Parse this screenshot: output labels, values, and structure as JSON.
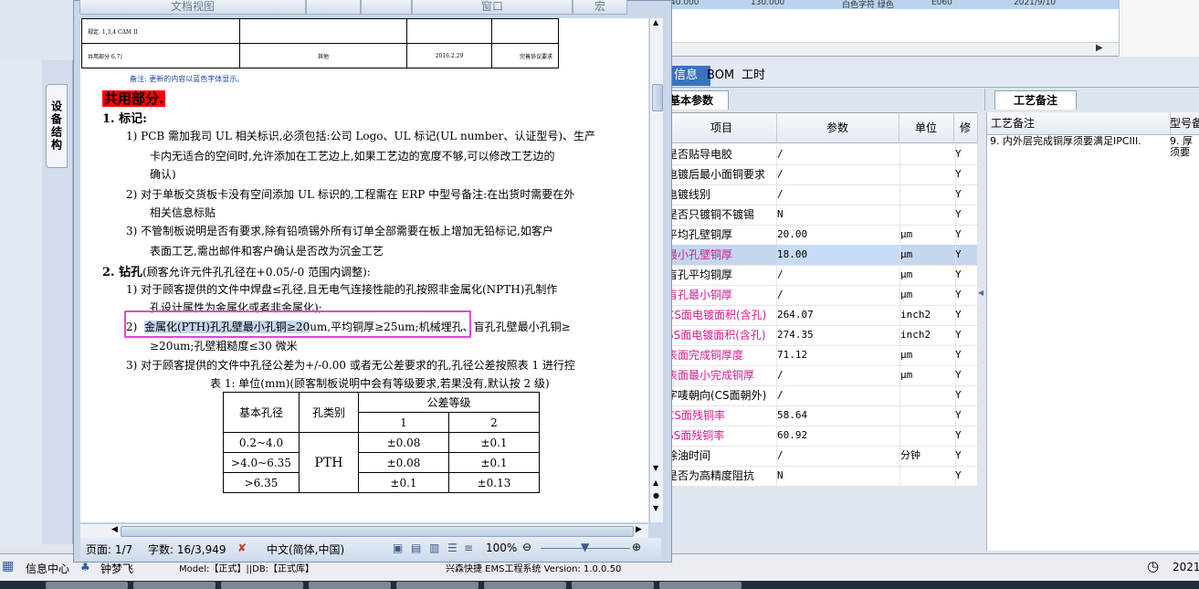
{
  "erp": {
    "top_row": [
      "40.000",
      "130.000",
      "白色字符  绿色",
      "E060",
      "2021/9/10"
    ],
    "tabs": [
      "信息",
      "BOM",
      "工时"
    ],
    "left_tab": "设备结构",
    "basic_params": {
      "section_title": "基本参数",
      "columns": [
        "项目",
        "参数",
        "单位",
        "修"
      ],
      "rows": [
        {
          "item": "是否贴导电胶",
          "value": "/",
          "unit": "",
          "flag": "Y"
        },
        {
          "item": "电镀后最小面铜要求",
          "value": "/",
          "unit": "",
          "flag": "Y"
        },
        {
          "item": "电镀线别",
          "value": "/",
          "unit": "",
          "flag": "Y"
        },
        {
          "item": "是否只镀铜不镀锡",
          "value": "N",
          "unit": "",
          "flag": "Y"
        },
        {
          "item": "平均孔壁铜厚",
          "value": "20.00",
          "unit": "μm",
          "flag": "Y"
        },
        {
          "item": "最小孔壁铜厚",
          "value": "18.00",
          "unit": "μm",
          "flag": "Y"
        },
        {
          "item": "盲孔平均铜厚",
          "value": "/",
          "unit": "μm",
          "flag": "Y"
        },
        {
          "item": "盲孔最小铜厚",
          "value": "/",
          "unit": "μm",
          "flag": "Y"
        },
        {
          "item": "CS面电镀面积(含孔)",
          "value": "264.07",
          "unit": "inch2",
          "flag": "Y"
        },
        {
          "item": "SS面电镀面积(含孔)",
          "value": "274.35",
          "unit": "inch2",
          "flag": "Y"
        },
        {
          "item": "表面完成铜厚度",
          "value": "71.12",
          "unit": "μm",
          "flag": "Y"
        },
        {
          "item": "表面最小完成铜厚",
          "value": "/",
          "unit": "μm",
          "flag": "Y"
        },
        {
          "item": "字唛朝向(CS面朝外)",
          "value": "/",
          "unit": "",
          "flag": "Y"
        },
        {
          "item": "CS面残铜率",
          "value": "58.64",
          "unit": "",
          "flag": "Y"
        },
        {
          "item": "SS面残铜率",
          "value": "60.92",
          "unit": "",
          "flag": "Y"
        },
        {
          "item": "除油时间",
          "value": "/",
          "unit": "分钟",
          "flag": "Y"
        },
        {
          "item": "是否为高精度阻抗",
          "value": "N",
          "unit": "",
          "flag": "Y"
        }
      ]
    },
    "craft": {
      "section_title": "工艺备注",
      "columns": [
        "工艺备注",
        "型号备"
      ],
      "row": {
        "note": "9.       内外层完成铜厚须要满足IPCIII.",
        "model_note": "9. 厚须要"
      }
    },
    "status": {
      "info_center": "信息中心",
      "user": "钟梦飞",
      "model": "Model:【正式】||DB:【正式库】",
      "system": "兴森快捷 EMS工程系统 Version: 1.0.0.50",
      "date": "2021-"
    }
  },
  "word": {
    "toolbar": [
      "文档视图",
      "",
      "",
      "窗口",
      "宏"
    ],
    "top_table": {
      "left": "规定. 1,3,4 CAM II",
      "c1": "共用部分 6.7)",
      "c2": "其他",
      "c3": "2016.2.29",
      "c4": "完善协议要求"
    },
    "note": "备注: 更新的内容以蓝色字体显示。",
    "heading": "共用部分.",
    "s1_title": "1.   标记:",
    "s1_1a": "1)   PCB 需加我司 UL 相关标识,必须包括:公司 Logo、UL 标记(UL number、认证型号)、生产",
    "s1_1b": "卡内无适合的空间时,允许添加在工艺边上,如果工艺边的宽度不够,可以修改工艺边的",
    "s1_1c": "确认)",
    "s1_2a": "2)   对于单板交货板卡没有空间添加 UL 标识的,工程需在 ERP 中型号备注:在出货时需要在外",
    "s1_2b": "相关信息标贴",
    "s1_3a": "3)   不管制板说明是否有要求,除有铅喷锡外所有订单全部需要在板上增加无铅标记,如客户",
    "s1_3b": "表面工艺,需出邮件和客户确认是否改为沉金工艺",
    "s2_title": "2.   钻孔",
    "s2_title_note": "(顾客允许元件孔孔径在+0.05/-0 范围内调整):",
    "s2_1a": "1)   对于顾客提供的文件中焊盘≤孔径,且无电气连接性能的孔按照非金属化(NPTH)孔制作",
    "s2_1b": "孔设计属性为金属化或者非金属化);",
    "s2_2_num": "2)",
    "s2_2_sel": "金属化(PTH)孔孔壁最小孔铜≥20",
    "s2_2_rest": "um,平均铜厚≥25um;机械埋孔、盲孔孔壁最小孔铜≥",
    "s2_2b": "≥20um;孔壁粗糙度≤30 微米",
    "s2_3a": "3)   对于顾客提供的文件中孔径公差为+/-0.00 或者无公差要求的孔,孔径公差按照表 1 进行控",
    "table_caption": "表 1: 单位(mm)(顾客制板说明中会有等级要求,若果没有,默认按 2 级)",
    "table": {
      "h_basic": "基本孔径",
      "h_type": "孔类别",
      "h_grade": "公差等级",
      "g1": "1",
      "g2": "2",
      "rows": [
        {
          "d": "0.2~4.0",
          "v1": "±0.08",
          "v2": "±0.1"
        },
        {
          "d": ">4.0~6.35",
          "v1": "±0.08",
          "v2": "±0.1"
        },
        {
          "d": ">6.35",
          "v1": "±0.1",
          "v2": "±0.13"
        }
      ],
      "type": "PTH"
    },
    "status": {
      "page": "页面: 1/7",
      "words": "字数: 16/3,949",
      "lang": "中文(简体,中国)",
      "zoom": "100%"
    }
  }
}
